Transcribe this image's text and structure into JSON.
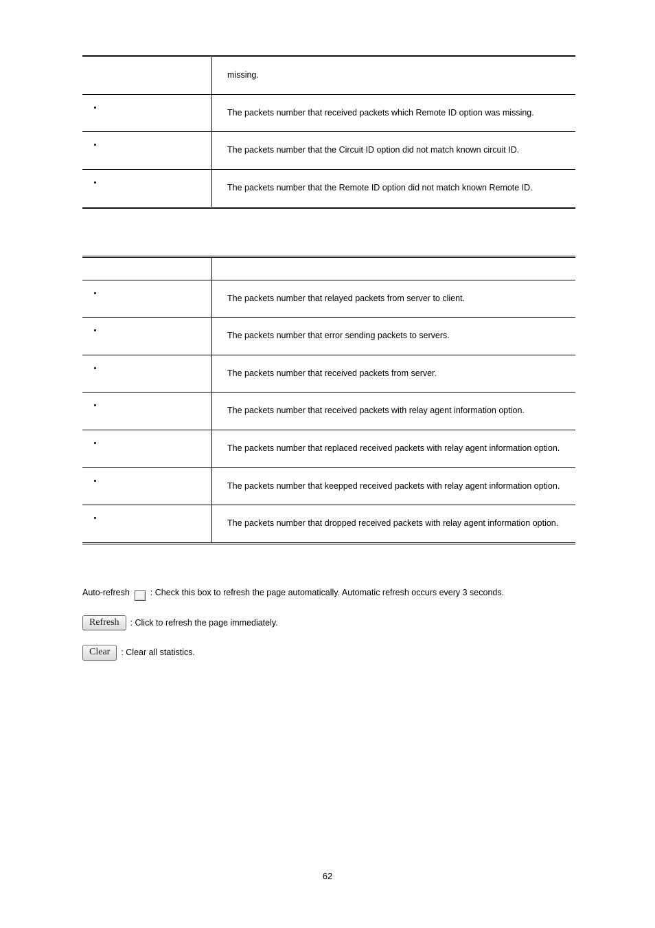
{
  "page_number": "62",
  "table1": {
    "rows": [
      {
        "desc_text": "missing."
      },
      {
        "desc_text": "The packets number that received packets which Remote ID option was missing."
      },
      {
        "desc_text": "The packets number that the Circuit ID option did not match known circuit ID."
      },
      {
        "desc_text": "The packets number that the Remote ID option did not match known Remote ID."
      }
    ]
  },
  "table2": {
    "header_text": "",
    "rows": [
      {
        "desc_text": "The packets number that relayed packets from server to client."
      },
      {
        "desc_text": "The packets number that error sending packets to servers."
      },
      {
        "desc_text": "The packets number that received packets from server."
      },
      {
        "desc_text": "The packets number that received packets with relay agent information option."
      },
      {
        "desc_text": "The packets number that replaced received packets with relay agent information option."
      },
      {
        "desc_text": "The packets number that keepped received packets with relay agent information option."
      },
      {
        "desc_text": "The packets number that dropped received packets with relay agent information option."
      }
    ]
  },
  "lines": {
    "autorefresh": {
      "label_before": "Auto-refresh",
      "text_after": " : Check this box to refresh the page automatically. Automatic refresh occurs every 3 seconds."
    },
    "refresh": {
      "button_label": "Refresh",
      "text_after": ": Click to refresh the page immediately."
    },
    "clear": {
      "button_label": "Clear",
      "text_after": ": Clear all statistics."
    }
  }
}
